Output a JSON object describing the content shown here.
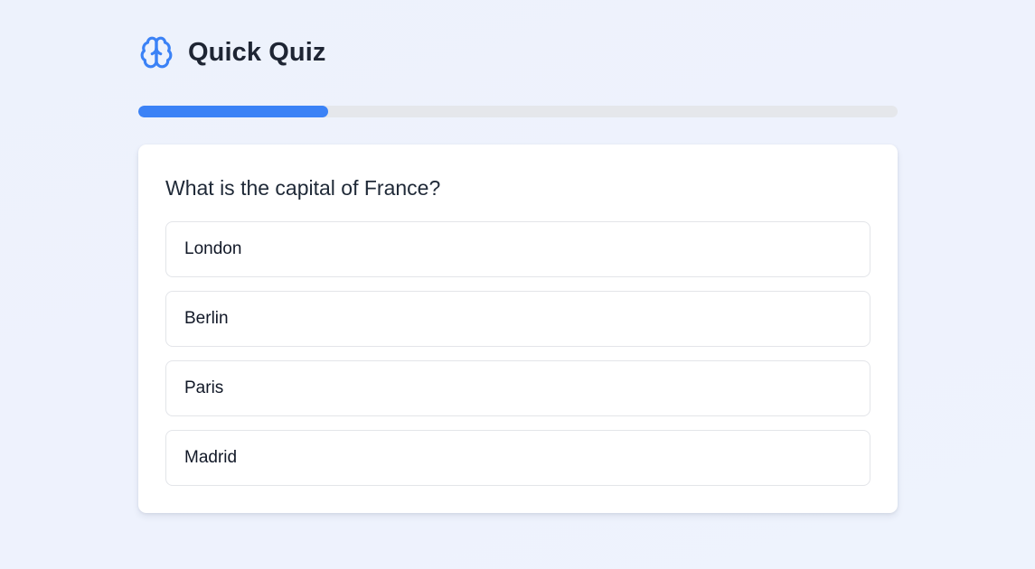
{
  "app": {
    "title": "Quick Quiz",
    "icon": "brain-icon"
  },
  "progress": {
    "fraction": 0.25
  },
  "question": {
    "text": "What is the capital of France?",
    "options": [
      {
        "label": "London"
      },
      {
        "label": "Berlin"
      },
      {
        "label": "Paris"
      },
      {
        "label": "Madrid"
      }
    ]
  },
  "colors": {
    "accent": "#3b82f6",
    "track": "#e5e7eb",
    "background": "#eef2fd",
    "text": "#1f2937"
  }
}
